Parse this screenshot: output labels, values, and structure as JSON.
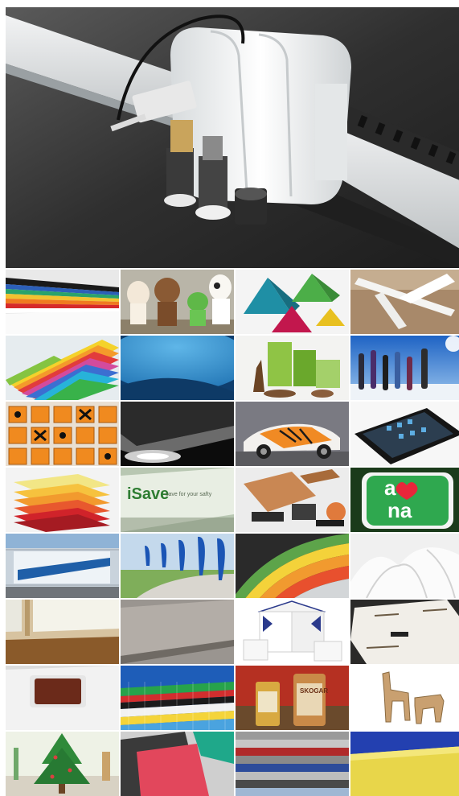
{
  "hero": {
    "subject": "flatbed-cutting-plotter-head"
  },
  "gallery": {
    "rows": 8,
    "columns": 4,
    "tiles": [
      {
        "subject": "stacked-colored-foam-boards"
      },
      {
        "subject": "cartoon-character-cutouts"
      },
      {
        "subject": "colorful-pyramid-gift-boxes"
      },
      {
        "subject": "white-foam-airplane-model"
      },
      {
        "subject": "fanned-colored-plastic-sheets"
      },
      {
        "subject": "blue-curved-surface"
      },
      {
        "subject": "green-packaging-with-wooden-animals"
      },
      {
        "subject": "snowboards-in-snow"
      },
      {
        "subject": "warning-sign-stickers"
      },
      {
        "subject": "car-headlight-black-film"
      },
      {
        "subject": "car-with-tiger-wrap"
      },
      {
        "subject": "black-tablet-device"
      },
      {
        "subject": "stacked-colored-acrylic-sheets"
      },
      {
        "subject": "isave-sign-panel",
        "texts": [
          "iSave",
          "save for your safty"
        ]
      },
      {
        "subject": "cork-and-rubber-parts"
      },
      {
        "subject": "green-logo-sign",
        "texts": [
          "a",
          "na"
        ]
      },
      {
        "subject": "building-billboard-banner"
      },
      {
        "subject": "feather-flag-banners"
      },
      {
        "subject": "curved-colored-stripes"
      },
      {
        "subject": "white-fabric-folds"
      },
      {
        "subject": "honeycomb-panel-corner"
      },
      {
        "subject": "grey-board-edge"
      },
      {
        "subject": "cardboard-stools"
      },
      {
        "subject": "cardboard-die-cut-sheet"
      },
      {
        "subject": "foam-board-with-brown-window"
      },
      {
        "subject": "corrugated-plastic-sheets"
      },
      {
        "subject": "product-label-bottles",
        "texts": [
          "SKOGAR"
        ]
      },
      {
        "subject": "cardboard-animal-models"
      },
      {
        "subject": "paper-christmas-tree"
      },
      {
        "subject": "gasket-material-sheets"
      },
      {
        "subject": "mesh-fabric-stack"
      },
      {
        "subject": "yellow-foam-block"
      }
    ]
  },
  "colors": {
    "hero_bg": "#3a3a3a",
    "machine_body": "#eef0f1",
    "rail": "#d9dcdd"
  }
}
